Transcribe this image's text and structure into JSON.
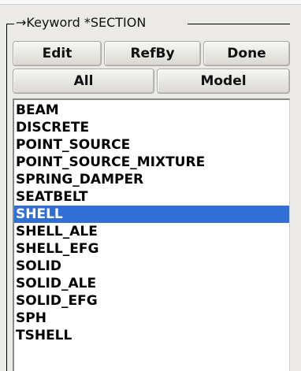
{
  "panel": {
    "title": "→Keyword *SECTION"
  },
  "buttons": {
    "edit": "Edit",
    "refby": "RefBy",
    "done": "Done",
    "all": "All",
    "model": "Model"
  },
  "list": {
    "items": [
      "BEAM",
      "DISCRETE",
      "POINT_SOURCE",
      "POINT_SOURCE_MIXTURE",
      "SPRING_DAMPER",
      "SEATBELT",
      "SHELL",
      "SHELL_ALE",
      "SHELL_EFG",
      "SOLID",
      "SOLID_ALE",
      "SOLID_EFG",
      "SPH",
      "TSHELL"
    ],
    "selected": "SHELL"
  },
  "colors": {
    "selection": "#2f6fd6",
    "panel_bg": "#ebeae6"
  }
}
